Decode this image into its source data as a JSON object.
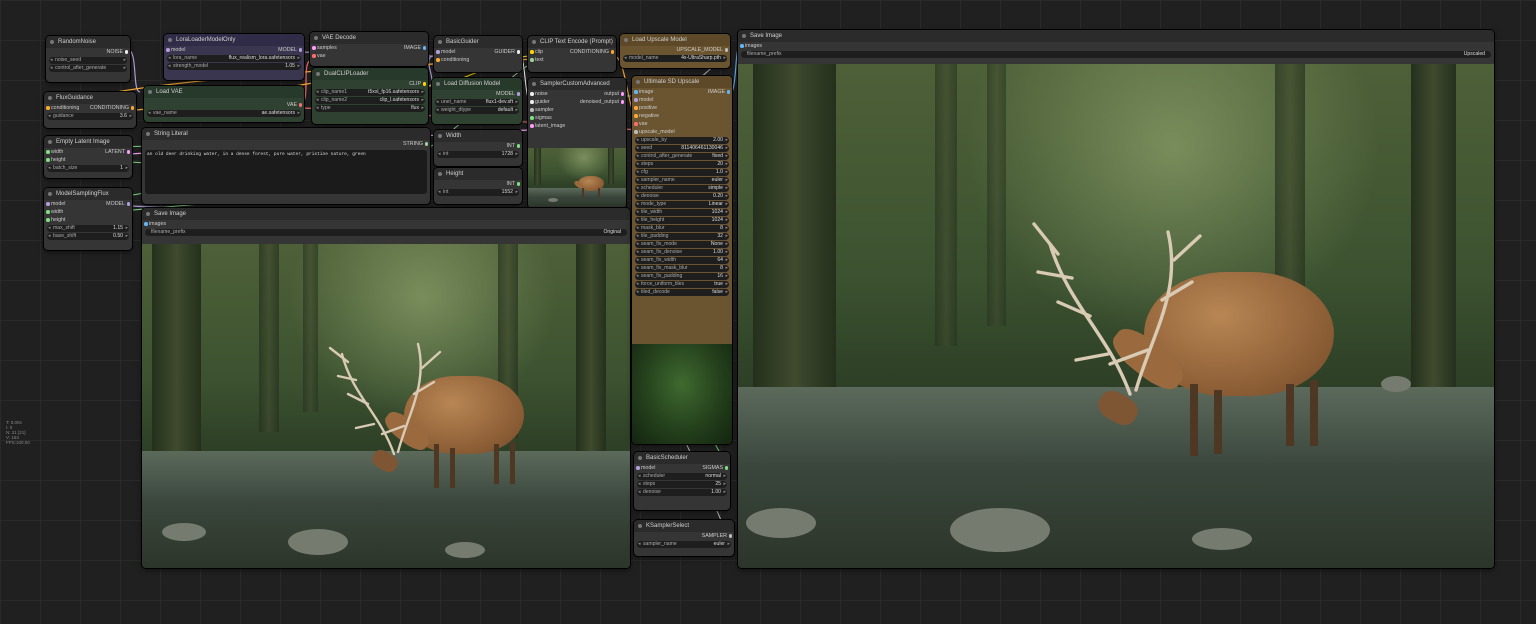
{
  "nodes": {
    "random_noise": {
      "title": "RandomNoise",
      "output": "NOISE",
      "noise_seed_label": "noise_seed",
      "noise_seed": "784732266173998",
      "control_label": "control_after_generate",
      "control_value": "randomize"
    },
    "lora_loader": {
      "title": "LoraLoaderModelOnly",
      "input": "model",
      "output": "MODEL",
      "lora_name_label": "lora_name",
      "lora_name": "flux_realism_lora.safetensors",
      "strength_label": "strength_model",
      "strength": "1.05"
    },
    "vae_decode": {
      "title": "VAE Decode",
      "input1": "samples",
      "input2": "vae",
      "output": "IMAGE"
    },
    "basic_guider": {
      "title": "BasicGuider",
      "input1": "model",
      "input2": "conditioning",
      "output": "GUIDER"
    },
    "clip_text_encode": {
      "title": "CLIP Text Encode (Prompt)",
      "input1": "clip",
      "input2": "text",
      "output": "CONDITIONING"
    },
    "load_upscale_model": {
      "title": "Load Upscale Model",
      "output": "UPSCALE_MODEL",
      "model_label": "model_name",
      "model_name": "4x-UltraSharp.pth"
    },
    "flux_guidance": {
      "title": "FluxGuidance",
      "input": "conditioning",
      "output": "CONDITIONING",
      "guidance_label": "guidance",
      "guidance": "3.6"
    },
    "load_vae": {
      "title": "Load VAE",
      "output": "VAE",
      "vae_label": "vae_name",
      "vae_name": "ae.safetensors"
    },
    "dual_clip_loader": {
      "title": "DualCLIPLoader",
      "output": "CLIP",
      "clip1_label": "clip_name1",
      "clip1": "t5xxl_fp16.safetensors",
      "clip2_label": "clip_name2",
      "clip2": "clip_l.safetensors",
      "type_label": "type",
      "type": "flux"
    },
    "load_diffusion_model": {
      "title": "Load Diffusion Model",
      "output": "MODEL",
      "unet_label": "unet_name",
      "unet_name": "flux1-dev.sft",
      "dtype_label": "weight_dtype",
      "dtype": "default"
    },
    "sampler_custom_advanced": {
      "title": "SamplerCustomAdvanced",
      "in1": "noise",
      "in2": "guider",
      "in3": "sampler",
      "in4": "sigmas",
      "in5": "latent_image",
      "out1": "output",
      "out2": "denoised_output"
    },
    "empty_latent": {
      "title": "Empty Latent Image",
      "in1": "width",
      "in2": "height",
      "output": "LATENT",
      "batch_label": "batch_size",
      "batch": "1"
    },
    "string_literal": {
      "title": "String Literal",
      "output": "STRING",
      "text": "an old deer drinking water, in a dense forest, pure water, pristine nature, green"
    },
    "width": {
      "title": "Width",
      "output": "INT",
      "label": "int",
      "value": "1728"
    },
    "height": {
      "title": "Height",
      "output": "INT",
      "label": "int",
      "value": "1552"
    },
    "model_sampling_flux": {
      "title": "ModelSamplingFlux",
      "in1": "model",
      "in2": "width",
      "in3": "height",
      "output": "MODEL",
      "max_shift_label": "max_shift",
      "max_shift": "1.15",
      "base_shift_label": "base_shift",
      "base_shift": "0.50"
    },
    "save_image_small": {
      "title": "Save Image",
      "input": "images",
      "prefix_label": "filename_prefix",
      "prefix": "Original"
    },
    "save_image_large": {
      "title": "Save Image",
      "input": "images",
      "prefix_label": "filename_prefix",
      "prefix": "Upscaled"
    },
    "ultimate_sd_upscale": {
      "title": "Ultimate SD Upscale",
      "inputs": [
        "image",
        "model",
        "positive",
        "negative",
        "vae",
        "upscale_model"
      ],
      "output": "IMAGE",
      "widgets": [
        {
          "k": "upscale_by",
          "v": "2.00"
        },
        {
          "k": "seed",
          "v": "811406461130046"
        },
        {
          "k": "control_after_generate",
          "v": "fixed"
        },
        {
          "k": "steps",
          "v": "20"
        },
        {
          "k": "cfg",
          "v": "1.0"
        },
        {
          "k": "sampler_name",
          "v": "euler"
        },
        {
          "k": "scheduler",
          "v": "simple"
        },
        {
          "k": "denoise",
          "v": "0.20"
        },
        {
          "k": "mode_type",
          "v": "Linear"
        },
        {
          "k": "tile_width",
          "v": "1024"
        },
        {
          "k": "tile_height",
          "v": "1024"
        },
        {
          "k": "mask_blur",
          "v": "8"
        },
        {
          "k": "tile_padding",
          "v": "32"
        },
        {
          "k": "seam_fix_mode",
          "v": "None"
        },
        {
          "k": "seam_fix_denoise",
          "v": "1.00"
        },
        {
          "k": "seam_fix_width",
          "v": "64"
        },
        {
          "k": "seam_fix_mask_blur",
          "v": "8"
        },
        {
          "k": "seam_fix_padding",
          "v": "16"
        },
        {
          "k": "force_uniform_tiles",
          "v": "true"
        },
        {
          "k": "tiled_decode",
          "v": "false"
        }
      ]
    },
    "basic_scheduler": {
      "title": "BasicScheduler",
      "input": "model",
      "output": "SIGMAS",
      "widgets": [
        {
          "k": "scheduler",
          "v": "normal"
        },
        {
          "k": "steps",
          "v": "25"
        },
        {
          "k": "denoise",
          "v": "1.00"
        }
      ]
    },
    "ksampler_select": {
      "title": "KSamplerSelect",
      "output": "SAMPLER",
      "sampler_label": "sampler_name",
      "sampler": "euler"
    }
  },
  "stats": [
    "T: 0.00s",
    "I: 0",
    "N: 21 [21]",
    "V: 153",
    "FPS:100.00"
  ],
  "colors": {
    "canvas": "#202020",
    "node": "#353535",
    "purple_node": "#3a3650",
    "green_node": "#2f4232",
    "brown_node": "#6b5530",
    "wire_model": "#b39ddb",
    "wire_clip": "#ffd500",
    "wire_vae": "#ff6e6e",
    "wire_latent": "#ff9cf9",
    "wire_image": "#64b5f6",
    "wire_conditioning": "#ffa931",
    "wire_int": "#7ee07e"
  }
}
